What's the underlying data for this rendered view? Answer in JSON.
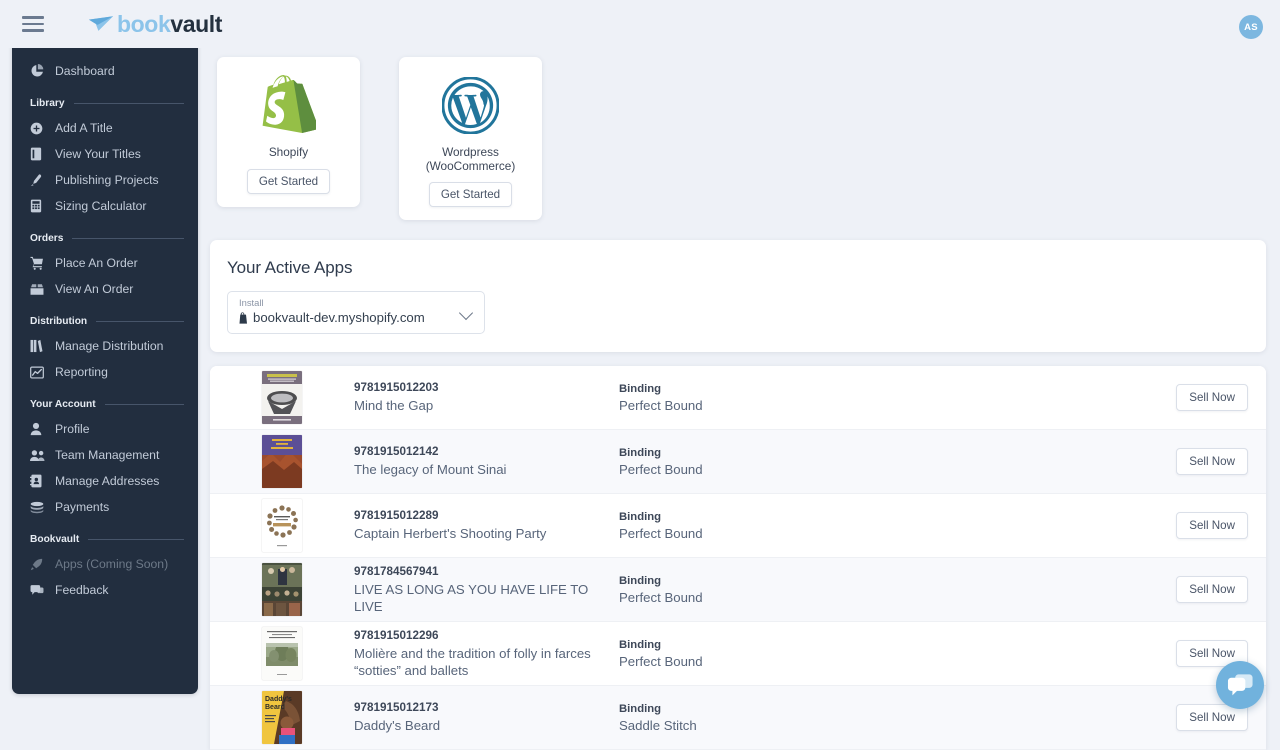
{
  "header": {
    "menu_icon": "hamburger-icon",
    "logo_part1": "book",
    "logo_part2": "vault",
    "avatar_initials": "AS"
  },
  "sidebar": {
    "top_item": {
      "label": "Dashboard",
      "icon": "pie-chart-icon"
    },
    "groups": [
      {
        "title": "Library",
        "items": [
          {
            "label": "Add A Title",
            "icon": "plus-circle-icon",
            "disabled": false
          },
          {
            "label": "View Your Titles",
            "icon": "book-icon",
            "disabled": false
          },
          {
            "label": "Publishing Projects",
            "icon": "pen-icon",
            "disabled": false
          },
          {
            "label": "Sizing Calculator",
            "icon": "calculator-icon",
            "disabled": false
          }
        ]
      },
      {
        "title": "Orders",
        "items": [
          {
            "label": "Place An Order",
            "icon": "shopping-cart-icon",
            "disabled": false
          },
          {
            "label": "View An Order",
            "icon": "open-box-icon",
            "disabled": false
          }
        ]
      },
      {
        "title": "Distribution",
        "items": [
          {
            "label": "Manage Distribution",
            "icon": "books-shelf-icon",
            "disabled": false
          },
          {
            "label": "Reporting",
            "icon": "line-chart-icon",
            "disabled": false
          }
        ]
      },
      {
        "title": "Your Account",
        "items": [
          {
            "label": "Profile",
            "icon": "user-icon",
            "disabled": false
          },
          {
            "label": "Team Management",
            "icon": "users-icon",
            "disabled": false
          },
          {
            "label": "Manage Addresses",
            "icon": "address-book-icon",
            "disabled": false
          },
          {
            "label": "Payments",
            "icon": "coins-icon",
            "disabled": false
          }
        ]
      },
      {
        "title": "Bookvault",
        "items": [
          {
            "label": "Apps (Coming Soon)",
            "icon": "rocket-icon",
            "disabled": true
          },
          {
            "label": "Feedback",
            "icon": "chat-bubbles-icon",
            "disabled": false
          }
        ]
      }
    ]
  },
  "app_cards": [
    {
      "name": "Shopify",
      "icon": "shopify-logo",
      "button": "Get Started"
    },
    {
      "name": "Wordpress\n(WooCommerce)",
      "icon": "wordpress-logo",
      "button": "Get Started"
    }
  ],
  "active_apps": {
    "title": "Your Active Apps",
    "select_label": "Install",
    "select_value": "bookvault-dev.myshopify.com",
    "select_icon": "shopify-bag-icon",
    "chevron": "chevron-down-icon"
  },
  "titles_list": {
    "binding_label": "Binding",
    "action_label": "Sell Now",
    "rows": [
      {
        "isbn": "9781915012203",
        "title": "Mind the Gap",
        "binding_label": "Binding",
        "binding": "Perfect Bound",
        "action": "Sell Now",
        "cover_alt": "Mind the Gap cover"
      },
      {
        "isbn": "9781915012142",
        "title": "The legacy of Mount Sinai",
        "binding_label": "Binding",
        "binding": "Perfect Bound",
        "action": "Sell Now",
        "cover_alt": "The legacy of Mount Sinai cover"
      },
      {
        "isbn": "9781915012289",
        "title": "Captain Herbert's Shooting Party",
        "binding_label": "Binding",
        "binding": "Perfect Bound",
        "action": "Sell Now",
        "cover_alt": "Captain Herbert's Shooting Party cover"
      },
      {
        "isbn": "9781784567941",
        "title": "LIVE AS LONG AS YOU HAVE LIFE TO LIVE",
        "binding_label": "Binding",
        "binding": "Perfect Bound",
        "action": "Sell Now",
        "cover_alt": "Live As Long As You Have Life To Live cover"
      },
      {
        "isbn": "9781915012296",
        "title": "Molière and the tradition of folly in farces “sotties” and ballets",
        "binding_label": "Binding",
        "binding": "Perfect Bound",
        "action": "Sell Now",
        "cover_alt": "Moliere cover"
      },
      {
        "isbn": "9781915012173",
        "title": "Daddy's Beard",
        "binding_label": "Binding",
        "binding": "Saddle Stitch",
        "action": "Sell Now",
        "cover_alt": "Daddy's Beard cover"
      }
    ]
  },
  "chat": {
    "icon": "chat-bubbles-icon"
  },
  "colors": {
    "sidebar_bg": "#222e3f",
    "page_bg": "#eef1f7",
    "accent_blue": "#8cc4ea",
    "logo_dark": "#24313f",
    "shopify_green": "#95BF47",
    "wordpress_blue": "#21759B",
    "chat_blue": "#71b2dd",
    "row_alt_bg": "#f8f9fc"
  }
}
